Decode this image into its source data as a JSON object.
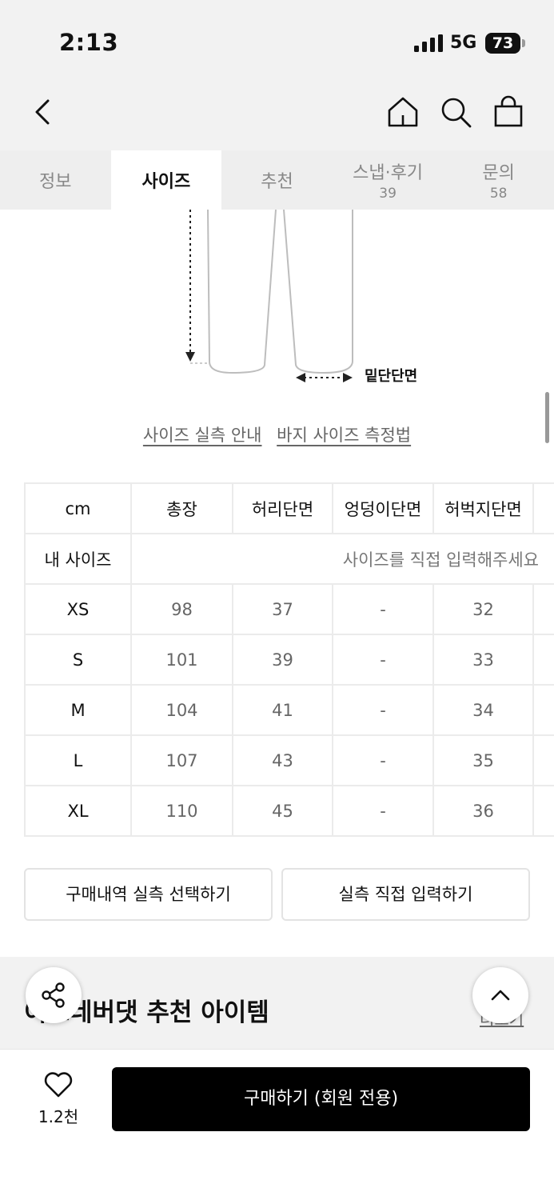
{
  "status_bar": {
    "time": "2:13",
    "network": "5G",
    "battery": "73"
  },
  "header": {
    "back_icon": "chevron-left-icon",
    "icons": [
      "home-icon",
      "search-icon",
      "shopping-bag-icon"
    ]
  },
  "tabs": [
    {
      "label": "정보",
      "count": ""
    },
    {
      "label": "사이즈",
      "count": ""
    },
    {
      "label": "추천",
      "count": ""
    },
    {
      "label": "스냅·후기",
      "count": "39"
    },
    {
      "label": "문의",
      "count": "58"
    }
  ],
  "active_tab": "사이즈",
  "diagram": {
    "label": "밑단단면"
  },
  "links": {
    "guide": "사이즈 실측 안내",
    "measure": "바지 사이즈 측정법"
  },
  "size_table": {
    "headers": [
      "cm",
      "총장",
      "허리단면",
      "엉덩이단면",
      "허벅지단면"
    ],
    "my_size": {
      "label": "내 사이즈",
      "placeholder": "사이즈를 직접 입력해주세요"
    },
    "rows": [
      {
        "size": "XS",
        "values": [
          "98",
          "37",
          "-",
          "32"
        ]
      },
      {
        "size": "S",
        "values": [
          "101",
          "39",
          "-",
          "33"
        ]
      },
      {
        "size": "M",
        "values": [
          "104",
          "41",
          "-",
          "34"
        ]
      },
      {
        "size": "L",
        "values": [
          "107",
          "43",
          "-",
          "35"
        ]
      },
      {
        "size": "XL",
        "values": [
          "110",
          "45",
          "-",
          "36"
        ]
      }
    ]
  },
  "buttons": {
    "purchase_history": "구매내역 실측 선택하기",
    "direct_input": "실측 직접 입력하기"
  },
  "recommend": {
    "title": "이즈네버댓 추천 아이템",
    "more": "더보기"
  },
  "bottom_bar": {
    "like_count": "1.2천",
    "buy_label": "구매하기 (회원 전용)"
  },
  "colors": {
    "accent": "#000000",
    "tab_bg": "#eeeeee",
    "text_muted": "#666666"
  }
}
